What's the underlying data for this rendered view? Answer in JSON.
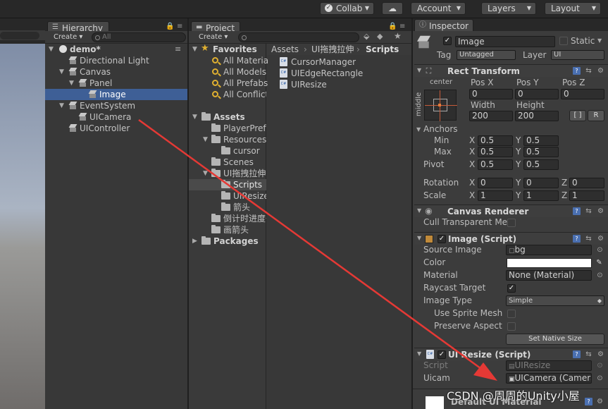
{
  "toolbar": {
    "collab": "Collab",
    "account": "Account",
    "layers": "Layers",
    "layout": "Layout"
  },
  "hierarchy": {
    "tab": "Hierarchy",
    "create": "Create",
    "search_placeholder": "All",
    "scene": "demo*",
    "items": [
      {
        "label": "Directional Light"
      },
      {
        "label": "Canvas"
      },
      {
        "label": "Panel"
      },
      {
        "label": "Image"
      },
      {
        "label": "EventSystem"
      },
      {
        "label": "UICamera"
      },
      {
        "label": "UIController"
      }
    ]
  },
  "project": {
    "tab": "Project",
    "create": "Create",
    "favorites": {
      "title": "Favorites",
      "items": [
        "All Materia",
        "All Models",
        "All Prefabs",
        "All Conflict"
      ]
    },
    "assets": {
      "title": "Assets",
      "items": [
        "PlayerPrefs",
        "Resources",
        "cursor",
        "Scenes",
        "UI拖拽拉伸",
        "Scripts",
        "UIResize",
        "箭头",
        "倒计时进度条",
        "画箭头"
      ],
      "packages": "Packages"
    },
    "breadcrumb": [
      "Assets",
      "UI拖拽拉伸",
      "Scripts"
    ],
    "files": [
      "CursorManager",
      "UIEdgeRectangle",
      "UIResize"
    ]
  },
  "inspector": {
    "tab": "Inspector",
    "object_name": "Image",
    "static_label": "Static",
    "tag_label": "Tag",
    "tag_value": "Untagged",
    "layer_label": "Layer",
    "layer_value": "UI",
    "rect_transform": {
      "title": "Rect Transform",
      "anchor_h": "center",
      "anchor_v": "middle",
      "pos_x_label": "Pos X",
      "pos_y_label": "Pos Y",
      "pos_z_label": "Pos Z",
      "pos_x": "0",
      "pos_y": "0",
      "pos_z": "0",
      "width_label": "Width",
      "height_label": "Height",
      "width": "200",
      "height": "200",
      "r_button": "R",
      "anchors_label": "Anchors",
      "min_label": "Min",
      "max_label": "Max",
      "min_x": "0.5",
      "min_y": "0.5",
      "max_x": "0.5",
      "max_y": "0.5",
      "pivot_label": "Pivot",
      "pivot_x": "0.5",
      "pivot_y": "0.5",
      "rotation_label": "Rotation",
      "rot_x": "0",
      "rot_y": "0",
      "rot_z": "0",
      "scale_label": "Scale",
      "scale_x": "1",
      "scale_y": "1",
      "scale_z": "1",
      "x": "X",
      "y": "Y",
      "z": "Z"
    },
    "canvas_renderer": {
      "title": "Canvas Renderer",
      "cull_label": "Cull Transparent Me"
    },
    "image_script": {
      "title": "Image (Script)",
      "source_image_label": "Source Image",
      "source_image_value": "bg",
      "color_label": "Color",
      "material_label": "Material",
      "material_value": "None (Material)",
      "raycast_label": "Raycast Target",
      "image_type_label": "Image Type",
      "image_type_value": "Simple",
      "use_sprite_mesh_label": "Use Sprite Mesh",
      "preserve_aspect_label": "Preserve Aspect",
      "set_native_size": "Set Native Size"
    },
    "ui_resize": {
      "title": "UI Resize (Script)",
      "script_label": "Script",
      "script_value": "UIResize",
      "uicam_label": "Uicam",
      "uicam_value": "UICamera (Camera)"
    },
    "default_material": "Default UI Material"
  },
  "watermark": "CSDN @周周的Unity小屋",
  "colors": {
    "selection": "#3e5f96",
    "annotation_arrow": "#e53935"
  }
}
